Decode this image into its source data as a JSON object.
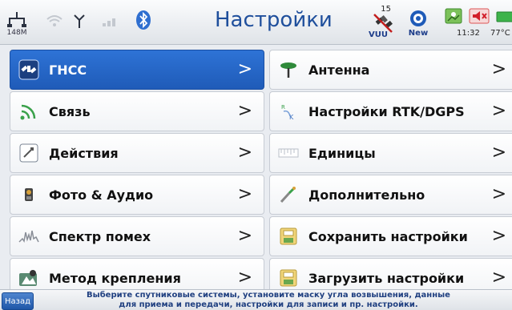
{
  "status": {
    "memory_label": "148M",
    "title": "Настройки",
    "satellite_count": "15",
    "satellite_label": "VUU",
    "new_label": "New",
    "time": "11:32",
    "temperature": "77°C"
  },
  "left_menu": [
    {
      "label": "ГНСС",
      "icon": "satellite-icon",
      "active": true
    },
    {
      "label": "Связь",
      "icon": "signal-icon",
      "active": false
    },
    {
      "label": "Действия",
      "icon": "actions-icon",
      "active": false
    },
    {
      "label": "Фото & Аудио",
      "icon": "camera-icon",
      "active": false
    },
    {
      "label": "Спектр помех",
      "icon": "spectrum-icon",
      "active": false
    },
    {
      "label": "Метод крепления",
      "icon": "mount-icon",
      "active": false
    }
  ],
  "right_menu": [
    {
      "label": "Антенна",
      "icon": "antenna-icon"
    },
    {
      "label": "Настройки RTK/DGPS",
      "icon": "rtk-icon"
    },
    {
      "label": "Единицы",
      "icon": "units-icon"
    },
    {
      "label": "Дополнительно",
      "icon": "advanced-icon"
    },
    {
      "label": "Сохранить настройки",
      "icon": "save-icon"
    },
    {
      "label": "Загрузить настройки",
      "icon": "load-icon"
    }
  ],
  "chevron": ">",
  "footer": {
    "back_label": "Назад",
    "hint_line1": "Выберите спутниковые системы, установите маску угла возвышения, данные",
    "hint_line2": "для приема и передачи, настройки для записи и пр. настройки."
  },
  "colors": {
    "accent": "#2e73d6",
    "title": "#1f4f9c"
  }
}
